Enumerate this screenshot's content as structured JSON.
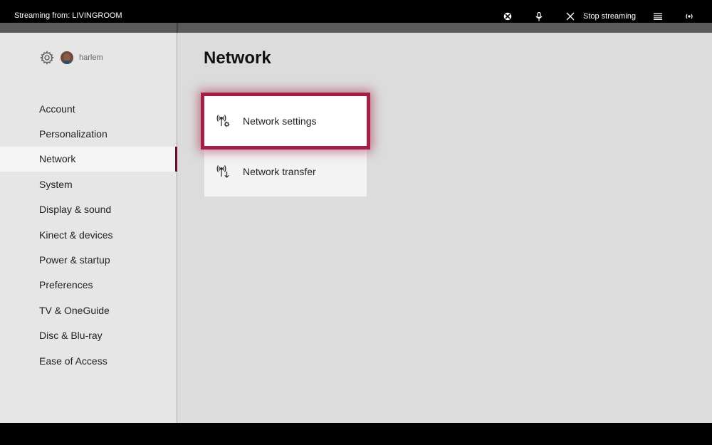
{
  "topbar": {
    "streaming_label": "Streaming from: LIVINGROOM",
    "stop_label": "Stop streaming",
    "icons": [
      "xbox-icon",
      "microphone-icon",
      "close-icon",
      "menu-icon",
      "broadcast-icon"
    ]
  },
  "user": {
    "name": "harlem"
  },
  "page": {
    "title": "Network"
  },
  "sidebar": {
    "items": [
      {
        "label": "Account"
      },
      {
        "label": "Personalization"
      },
      {
        "label": "Network",
        "active": true
      },
      {
        "label": "System"
      },
      {
        "label": "Display & sound"
      },
      {
        "label": "Kinect & devices"
      },
      {
        "label": "Power & startup"
      },
      {
        "label": "Preferences"
      },
      {
        "label": "TV & OneGuide"
      },
      {
        "label": "Disc & Blu-ray"
      },
      {
        "label": "Ease of Access"
      }
    ]
  },
  "tiles": [
    {
      "label": "Network settings",
      "focused": true
    },
    {
      "label": "Network transfer",
      "focused": false
    }
  ],
  "colors": {
    "accent": "#a31f45",
    "active_marker": "#6b0f2a"
  }
}
